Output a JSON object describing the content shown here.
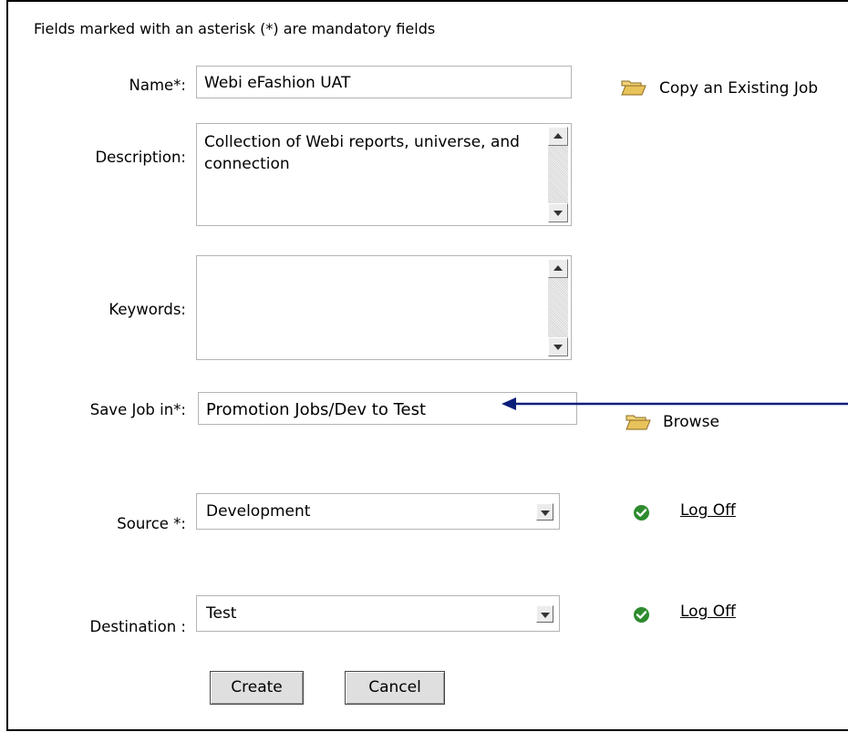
{
  "header": {
    "note": "Fields marked with an asterisk (*) are mandatory fields"
  },
  "name": {
    "label": "Name*:",
    "value": "Webi eFashion UAT"
  },
  "copy_job": {
    "label": "Copy an Existing Job"
  },
  "description": {
    "label": "Description:",
    "value": "Collection of Webi reports, universe, and connection"
  },
  "keywords": {
    "label": "Keywords:",
    "value": ""
  },
  "save_job_in": {
    "label": "Save Job in*:",
    "value": "Promotion Jobs/Dev to Test"
  },
  "browse": {
    "label": "Browse"
  },
  "source": {
    "label": "Source *:",
    "selected": "Development",
    "logoff": "Log Off"
  },
  "destination": {
    "label": "Destination :",
    "selected": "Test",
    "logoff": "Log Off"
  },
  "buttons": {
    "create": "Create",
    "cancel": "Cancel"
  },
  "colors": {
    "arrow": "#0b1f7a",
    "folder": "#e8c25a",
    "check": "#2e8b2e",
    "border": "#b4b4b4"
  }
}
